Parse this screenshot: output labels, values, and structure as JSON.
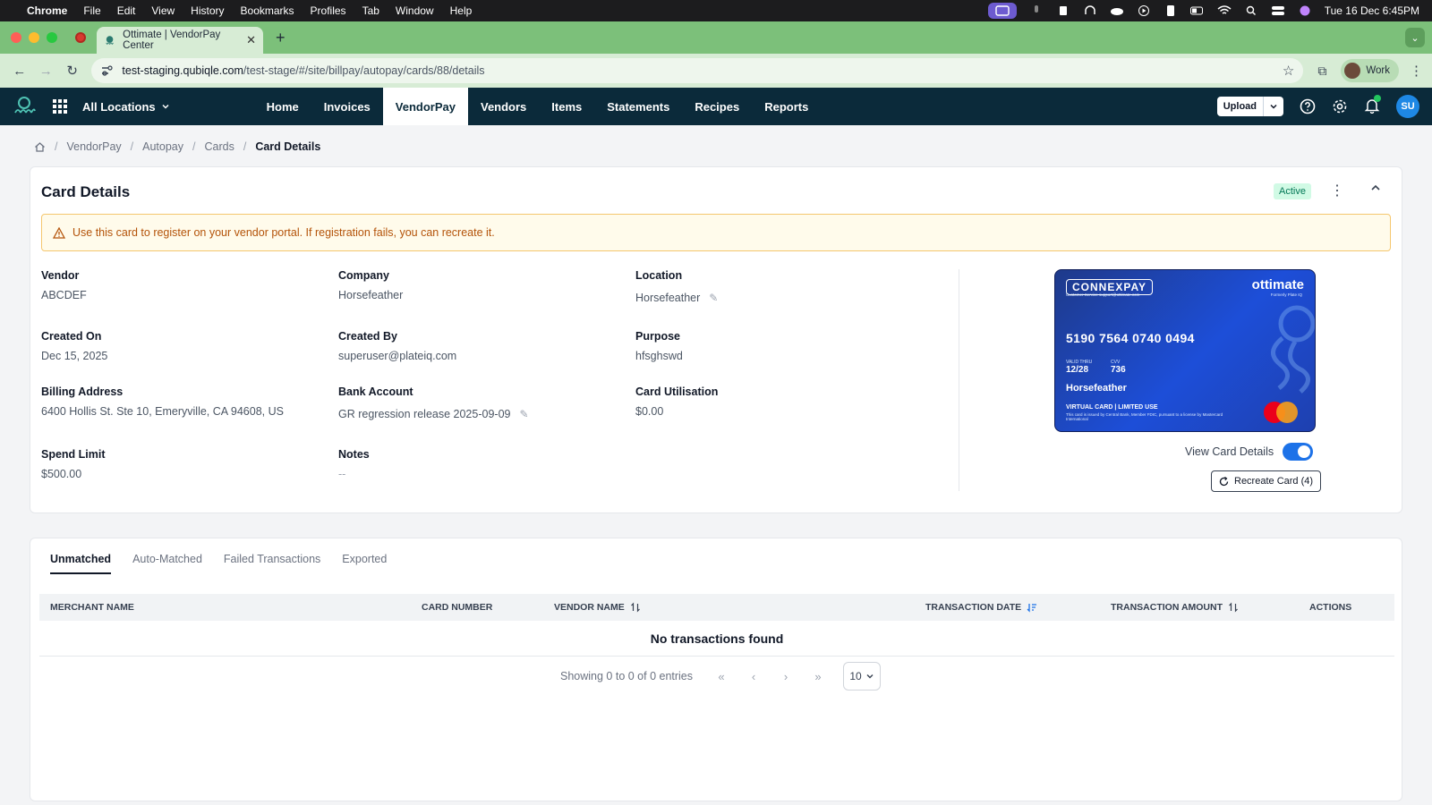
{
  "menubar": {
    "app": "Chrome",
    "items": [
      "File",
      "Edit",
      "View",
      "History",
      "Bookmarks",
      "Profiles",
      "Tab",
      "Window",
      "Help"
    ],
    "datetime": "Tue 16 Dec  6:45PM"
  },
  "browser": {
    "tab_title": "Ottimate | VendorPay Center",
    "url_host": "test-staging.qubiqle.com",
    "url_path": "/test-stage/#/site/billpay/autopay/cards/88/details",
    "profile": "Work"
  },
  "appnav": {
    "location": "All Locations",
    "links": [
      "Home",
      "Invoices",
      "VendorPay",
      "Vendors",
      "Items",
      "Statements",
      "Recipes",
      "Reports"
    ],
    "active_link": "VendorPay",
    "upload_label": "Upload",
    "avatar": "SU"
  },
  "breadcrumb": [
    "VendorPay",
    "Autopay",
    "Cards",
    "Card Details"
  ],
  "card_details": {
    "title": "Card Details",
    "status": "Active",
    "alert": "Use this card to register on your vendor portal. If registration fails, you can recreate it.",
    "fields": {
      "vendor": {
        "label": "Vendor",
        "value": "ABCDEF"
      },
      "company": {
        "label": "Company",
        "value": "Horsefeather"
      },
      "location": {
        "label": "Location",
        "value": "Horsefeather"
      },
      "created_on": {
        "label": "Created On",
        "value": "Dec 15, 2025"
      },
      "created_by": {
        "label": "Created By",
        "value": "superuser@plateiq.com"
      },
      "purpose": {
        "label": "Purpose",
        "value": "hfsghswd"
      },
      "billing_address": {
        "label": "Billing Address",
        "value": "6400 Hollis St. Ste 10, Emeryville, CA 94608, US"
      },
      "bank_account": {
        "label": "Bank Account",
        "value": "GR regression release 2025-09-09"
      },
      "card_utilisation": {
        "label": "Card Utilisation",
        "value": "$0.00"
      },
      "spend_limit": {
        "label": "Spend Limit",
        "value": "$500.00"
      },
      "notes": {
        "label": "Notes",
        "value": "--"
      }
    },
    "virtual_card": {
      "issuer_brand": "CONNEXPAY",
      "issuer_sub": "Customer Service support@ottimate.com",
      "brand": "ottimate",
      "brand_sub": "Formerly Plate IQ",
      "number": "5190 7564 0740 0494",
      "valid_thru_label": "VALID THRU",
      "valid_thru": "12/28",
      "cvv_label": "CVV",
      "cvv": "736",
      "holder": "Horsefeather",
      "type": "VIRTUAL CARD | LIMITED USE",
      "fine_print": "This card is issued by Central Bank, Member FDIC, pursuant to a license by Mastercard International"
    },
    "view_card_details_label": "View Card Details",
    "view_card_details_on": true,
    "recreate_label": "Recreate Card (4)"
  },
  "transactions": {
    "tabs": [
      "Unmatched",
      "Auto-Matched",
      "Failed Transactions",
      "Exported"
    ],
    "active_tab": "Unmatched",
    "columns": [
      "MERCHANT NAME",
      "CARD NUMBER",
      "VENDOR NAME",
      "TRANSACTION DATE",
      "TRANSACTION AMOUNT",
      "ACTIONS"
    ],
    "empty_message": "No transactions found",
    "pagination_text": "Showing 0 to 0 of 0 entries",
    "page_size": "10"
  }
}
